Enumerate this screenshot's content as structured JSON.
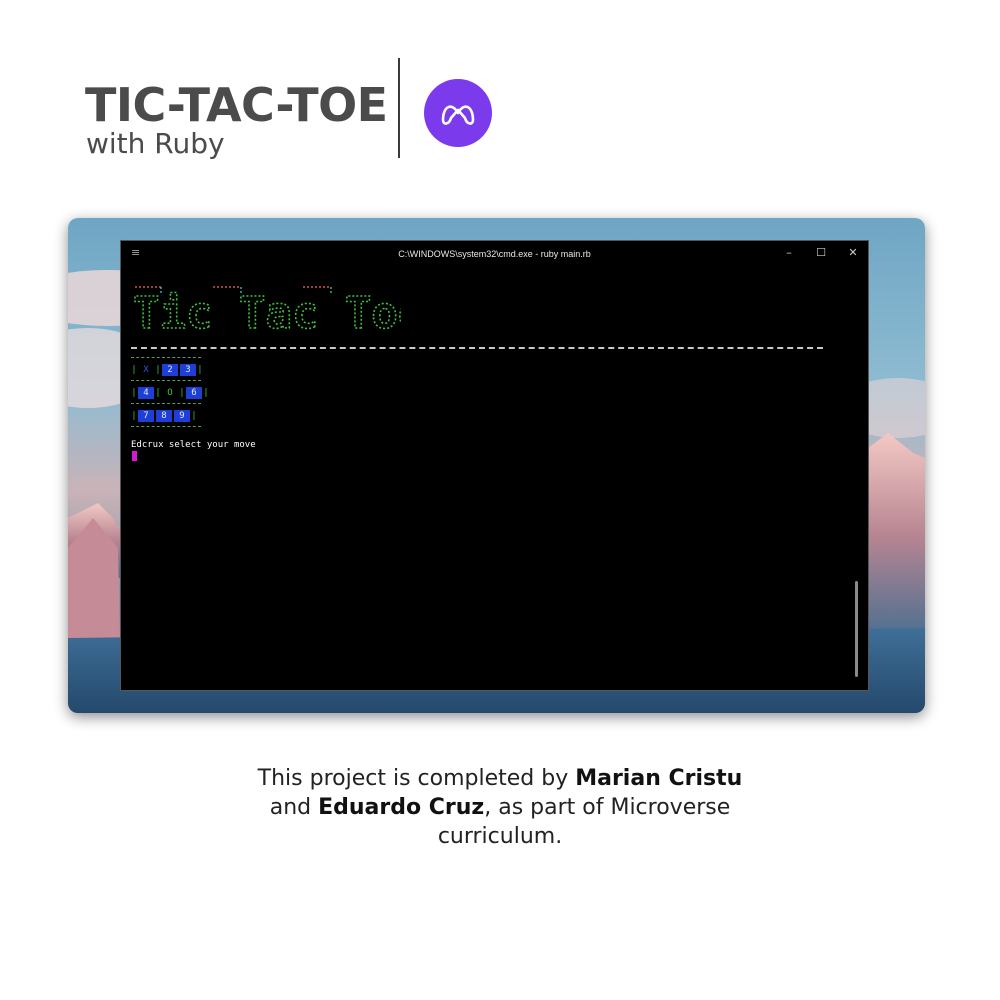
{
  "header": {
    "title": "TIC-TAC-TOE",
    "subtitle": "with Ruby",
    "logo_icon": "microverse-logo-icon",
    "logo_color": "#7c3aed"
  },
  "window": {
    "title": "C:\\WINDOWS\\system32\\cmd.exe - ruby main.rb",
    "menu_glyph": "≡",
    "controls": {
      "minimize": "–",
      "maximize": "☐",
      "close": "✕"
    }
  },
  "terminal": {
    "banner_text": "Tic Tac Toe",
    "board": [
      [
        "X",
        "2",
        "3"
      ],
      [
        "4",
        "O",
        "6"
      ],
      [
        "7",
        "8",
        "9"
      ]
    ],
    "prompt": "Edcrux select your move",
    "cursor_color": "#d21ad2"
  },
  "footer": {
    "line1_prefix": "This project is completed by ",
    "author1": "Marian Cristu",
    "line2_prefix": "and ",
    "author2": "Eduardo Cruz",
    "line2_suffix": ", as part of Microverse",
    "line3": "curriculum."
  }
}
